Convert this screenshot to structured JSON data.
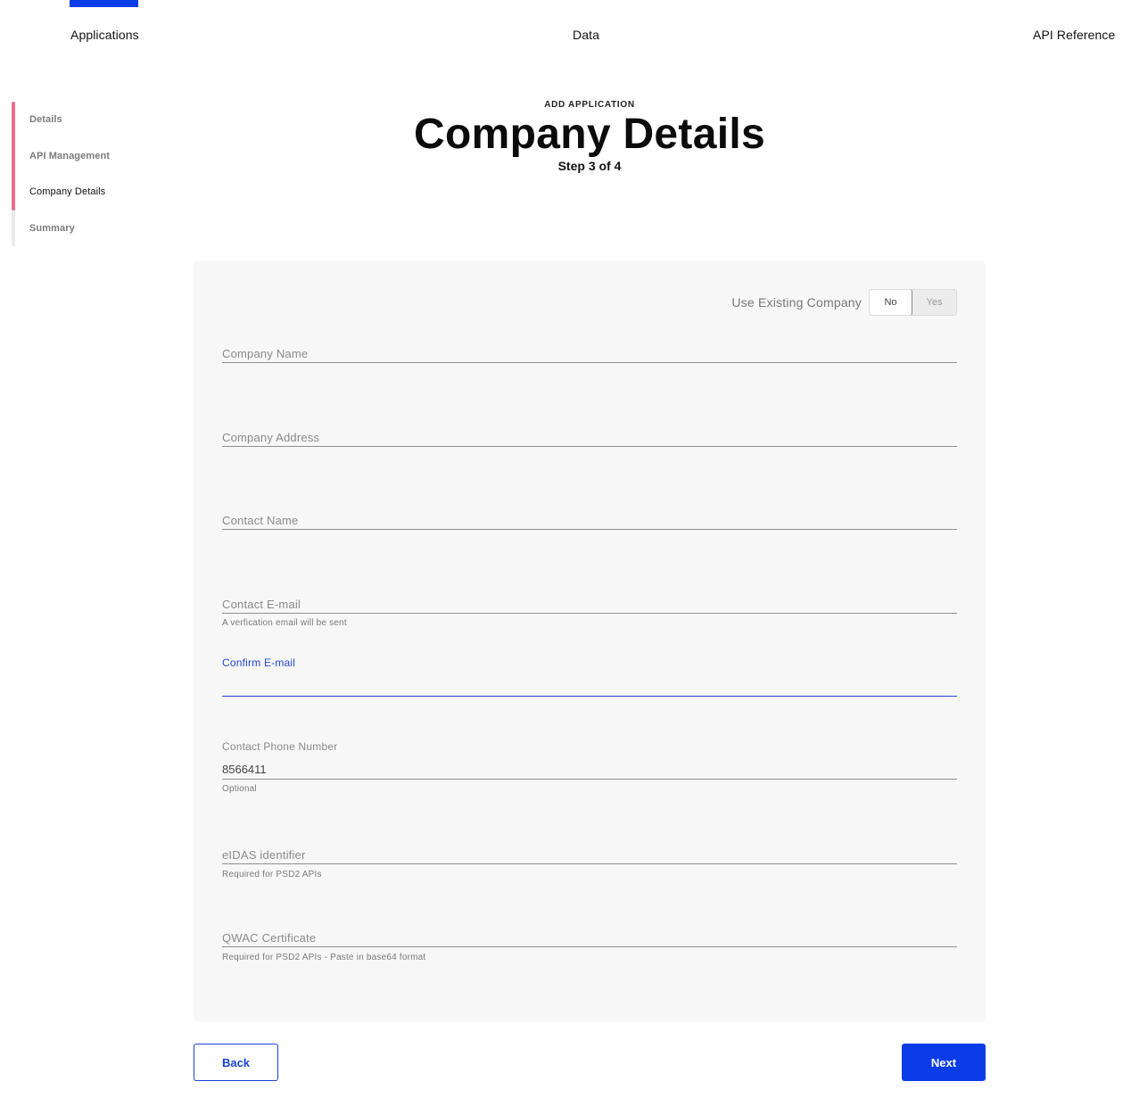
{
  "nav": {
    "items": [
      {
        "label": "Applications",
        "active": true
      },
      {
        "label": "Data",
        "active": false
      },
      {
        "label": "API Reference",
        "active": false
      }
    ],
    "accent_color": "#0a3ce8"
  },
  "stepper": {
    "accent_color": "#ed6a8e",
    "steps": [
      {
        "label": "Details",
        "state": "complete"
      },
      {
        "label": "API Management",
        "state": "complete"
      },
      {
        "label": "Company Details",
        "state": "current"
      },
      {
        "label": "Summary",
        "state": "upcoming"
      }
    ]
  },
  "header": {
    "eyebrow": "ADD APPLICATION",
    "title": "Company Details",
    "subtitle": "Step 3 of 4"
  },
  "form": {
    "existing_company": {
      "label": "Use Existing Company",
      "options": [
        "No",
        "Yes"
      ],
      "selected": "No"
    },
    "fields": {
      "company_name": {
        "placeholder": "Company Name",
        "value": ""
      },
      "company_address": {
        "placeholder": "Company Address",
        "value": ""
      },
      "contact_name": {
        "placeholder": "Contact Name",
        "value": ""
      },
      "contact_email": {
        "placeholder": "Contact E-mail",
        "value": "",
        "hint": "A verfication email will be sent"
      },
      "confirm_email": {
        "label": "Confirm E-mail",
        "value": "",
        "focused": true
      },
      "contact_phone": {
        "label": "Contact Phone Number",
        "value": "8566411",
        "hint": "Optional"
      },
      "eidas": {
        "placeholder": "eIDAS identifier",
        "value": "",
        "hint": "Required for PSD2 APIs"
      },
      "qwac": {
        "placeholder": "QWAC Certificate",
        "value": "",
        "hint": "Required for PSD2 APIs - Paste in base64 format"
      }
    }
  },
  "footer": {
    "back_label": "Back",
    "next_label": "Next"
  }
}
